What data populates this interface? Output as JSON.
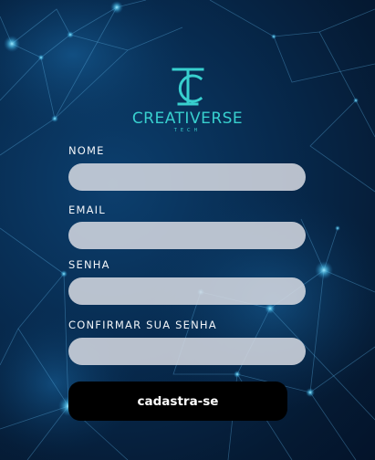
{
  "brand": {
    "logo_icon": "tc-monogram-icon",
    "name": "CREATIVERSE",
    "tagline": "TECH"
  },
  "form": {
    "name_label": "NOME",
    "name_value": "",
    "email_label": "EMAIL",
    "email_value": "",
    "password_label": "SENHA",
    "password_value": "",
    "confirm_label": "CONFIRMAR SUA SENHA",
    "confirm_value": "",
    "submit_label": "cadastra-se"
  },
  "colors": {
    "accent": "#38d0cf",
    "background": "#072a4e",
    "input_fill": "#d6dae2",
    "button_fill": "#000000",
    "label_text": "#f1f4f8"
  }
}
